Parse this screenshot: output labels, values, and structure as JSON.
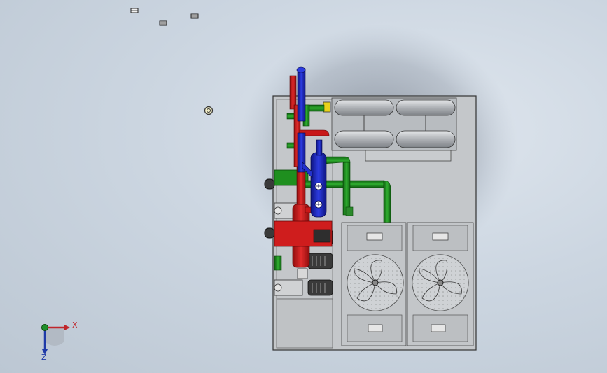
{
  "triad": {
    "x_label": "X",
    "z_label": "Z"
  },
  "colors": {
    "background": "#c9d3de",
    "frame_fill": "#c6c9cc",
    "hot_pipe": "#d11a1a",
    "cold_pipe": "#1a24c8",
    "return_pipe": "#1f8f1f",
    "cylinder": "#b5b8bc",
    "accent_yellow": "#e8d21a"
  },
  "icons": [
    "sketch-point-icon",
    "origin-marker-icon",
    "axis-triad-icon"
  ]
}
